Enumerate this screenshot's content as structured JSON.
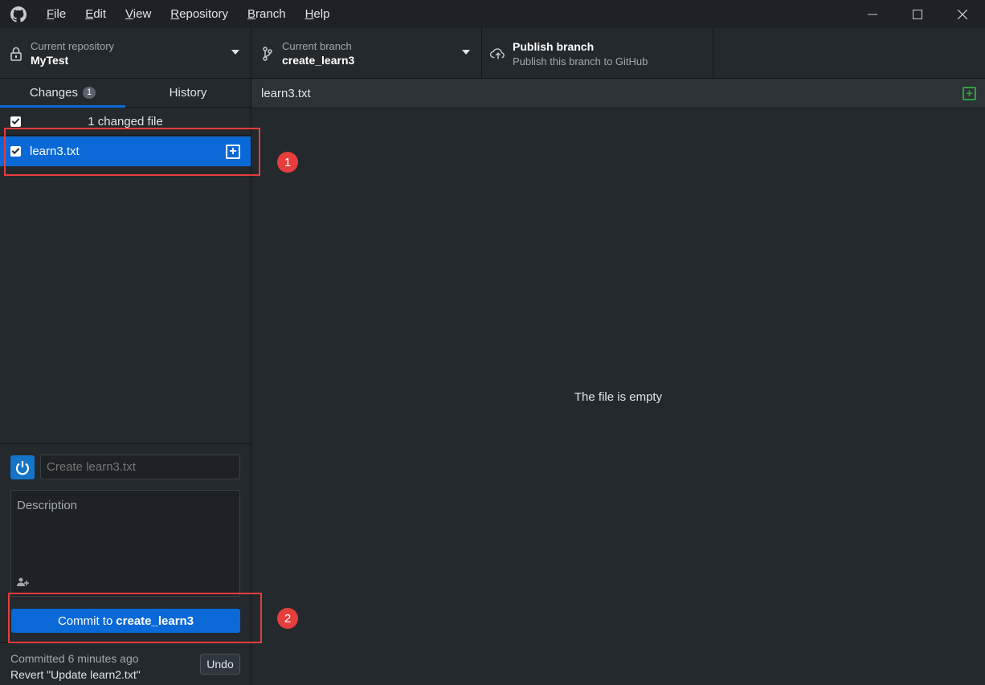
{
  "menu": {
    "items": [
      {
        "prefix": "",
        "underline": "F",
        "rest": "ile"
      },
      {
        "prefix": "",
        "underline": "E",
        "rest": "dit"
      },
      {
        "prefix": "",
        "underline": "V",
        "rest": "iew"
      },
      {
        "prefix": "",
        "underline": "R",
        "rest": "epository"
      },
      {
        "prefix": "",
        "underline": "B",
        "rest": "ranch"
      },
      {
        "prefix": "",
        "underline": "H",
        "rest": "elp"
      }
    ]
  },
  "toolbar": {
    "repo_label": "Current repository",
    "repo_value": "MyTest",
    "branch_label": "Current branch",
    "branch_value": "create_learn3",
    "publish_title": "Publish branch",
    "publish_sub": "Publish this branch to GitHub"
  },
  "tabs": {
    "changes_label": "Changes",
    "changes_count": "1",
    "history_label": "History"
  },
  "changes": {
    "header": "1 changed file",
    "files": [
      {
        "name": "learn3.txt"
      }
    ]
  },
  "commit": {
    "summary_placeholder": "Create learn3.txt",
    "description_placeholder": "Description",
    "button_prefix": "Commit to",
    "button_branch": "create_learn3"
  },
  "last_commit": {
    "time": "Committed 6 minutes ago",
    "message": "Revert \"Update learn2.txt\"",
    "undo_label": "Undo"
  },
  "diff": {
    "filename": "learn3.txt",
    "empty_message": "The file is empty"
  },
  "annotations": {
    "marker1": "1",
    "marker2": "2"
  },
  "colors": {
    "accent": "#0a69d6",
    "annotation": "#e63d3d",
    "added": "#2ea043"
  }
}
